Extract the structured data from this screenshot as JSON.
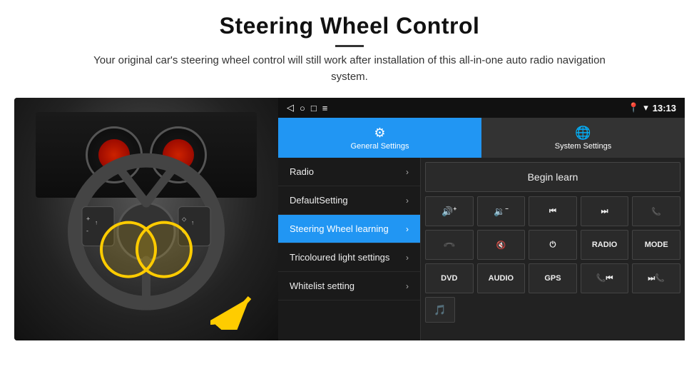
{
  "header": {
    "title": "Steering Wheel Control",
    "divider": true,
    "description": "Your original car's steering wheel control will still work after installation of this all-in-one auto radio navigation system."
  },
  "status_bar": {
    "icons": [
      "◁",
      "○",
      "□",
      "≡"
    ],
    "right_icons": [
      "📍",
      "▾"
    ],
    "time": "13:13"
  },
  "tabs": [
    {
      "id": "general",
      "label": "General Settings",
      "active": true
    },
    {
      "id": "system",
      "label": "System Settings",
      "active": false
    }
  ],
  "menu_items": [
    {
      "id": "radio",
      "label": "Radio",
      "active": false
    },
    {
      "id": "default",
      "label": "DefaultSetting",
      "active": false
    },
    {
      "id": "steering",
      "label": "Steering Wheel learning",
      "active": true
    },
    {
      "id": "tricoloured",
      "label": "Tricoloured light settings",
      "active": false
    },
    {
      "id": "whitelist",
      "label": "Whitelist setting",
      "active": false
    }
  ],
  "begin_learn_label": "Begin learn",
  "control_buttons_row1": [
    {
      "id": "vol_up",
      "icon": "🔊+",
      "symbol": "🔊",
      "label": "vol-up"
    },
    {
      "id": "vol_down",
      "icon": "🔉-",
      "symbol": "🔉",
      "label": "vol-down"
    },
    {
      "id": "prev",
      "symbol": "⏮",
      "label": "prev"
    },
    {
      "id": "next",
      "symbol": "⏭",
      "label": "next"
    },
    {
      "id": "phone",
      "symbol": "📞",
      "label": "phone"
    }
  ],
  "control_buttons_row2": [
    {
      "id": "phone_end",
      "symbol": "📵",
      "label": "phone-end"
    },
    {
      "id": "mute",
      "symbol": "🔇",
      "label": "mute"
    },
    {
      "id": "power",
      "symbol": "⏻",
      "label": "power"
    },
    {
      "id": "radio_btn",
      "text": "RADIO",
      "label": "radio-btn"
    },
    {
      "id": "mode_btn",
      "text": "MODE",
      "label": "mode-btn"
    }
  ],
  "control_buttons_row3": [
    {
      "id": "dvd_btn",
      "text": "DVD",
      "label": "dvd-btn"
    },
    {
      "id": "audio_btn",
      "text": "AUDIO",
      "label": "audio-btn"
    },
    {
      "id": "gps_btn",
      "text": "GPS",
      "label": "gps-btn"
    },
    {
      "id": "phone2",
      "symbol": "📞⏮",
      "label": "phone2"
    },
    {
      "id": "back2",
      "symbol": "⏭📞",
      "label": "back2"
    }
  ],
  "last_row": [
    {
      "id": "icon1",
      "symbol": "🎵",
      "label": "media-icon"
    }
  ]
}
